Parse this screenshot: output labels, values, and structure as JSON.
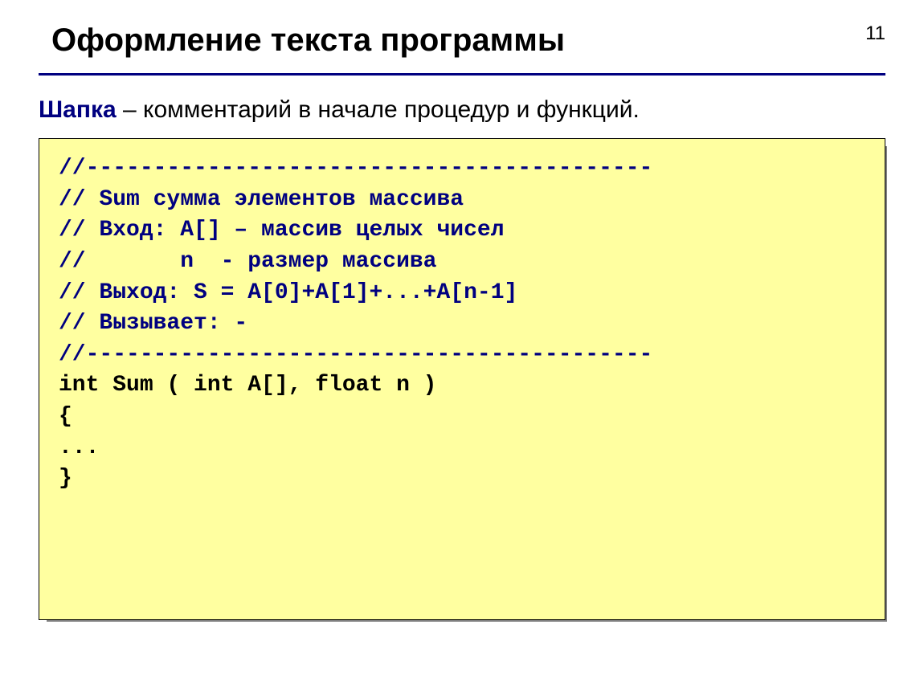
{
  "page_number": "11",
  "title": "Оформление текста программы",
  "subtitle_lead": "Шапка",
  "subtitle_rest": " – комментарий в начале процедур и функций.",
  "code_lines": {
    "l1": "//------------------------------------------",
    "l2": "// Sum сумма элементов массива",
    "l3": "// Вход: A[] – массив целых чисел",
    "l4": "//       n  - размер массива",
    "l5": "// Выход: S = A[0]+A[1]+...+A[n-1]",
    "l6": "// Вызывает: -",
    "l7": "//------------------------------------------",
    "l8": "int Sum ( int A[], float n )",
    "l9": "{",
    "l10": "...",
    "l11": "}"
  }
}
